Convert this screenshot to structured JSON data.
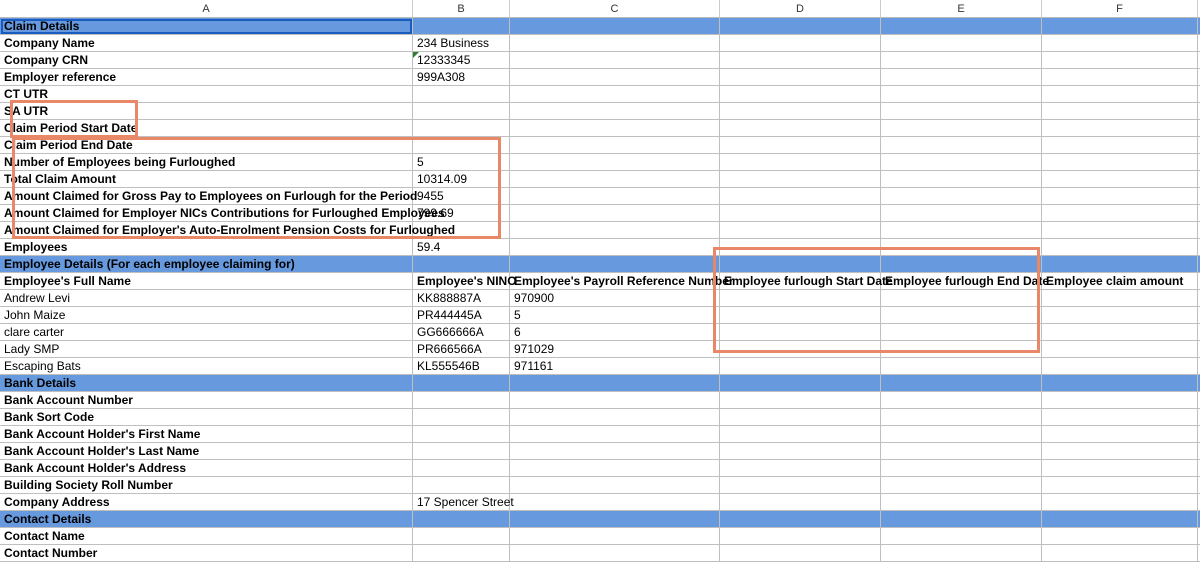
{
  "columns": [
    "A",
    "B",
    "C",
    "D",
    "E",
    "F"
  ],
  "sections": {
    "claim_details_header": "Claim Details",
    "employee_details_header": "Employee Details (For each employee claiming for)",
    "bank_details_header": "Bank Details",
    "contact_details_header": "Contact Details"
  },
  "claim_details": {
    "company_name": {
      "label": "Company Name",
      "value": "234 Business"
    },
    "company_crn": {
      "label": "Company CRN",
      "value": "12333345"
    },
    "employer_reference": {
      "label": "Employer reference",
      "value": "999A308"
    },
    "ct_utr": {
      "label": "CT UTR",
      "value": ""
    },
    "sa_utr": {
      "label": "SA UTR",
      "value": ""
    },
    "claim_period_start": {
      "label": "Claim Period Start Date",
      "value": ""
    },
    "claim_period_end": {
      "label": "Claim Period End Date",
      "value": ""
    },
    "num_employees": {
      "label": "Number of Employees being Furloughed",
      "value": "5"
    },
    "total_claim": {
      "label": "Total Claim Amount",
      "value": "10314.09"
    },
    "gross_pay": {
      "label": "Amount Claimed for Gross Pay to Employees on Furlough for the Period",
      "value": "9455"
    },
    "nics": {
      "label": "Amount Claimed for Employer NICs Contributions for Furloughed Employees",
      "value": "799.69"
    },
    "pension1": {
      "label": "Amount Claimed for Employer's Auto-Enrolment Pension Costs for Furloughed",
      "value": ""
    },
    "pension2": {
      "label": "Employees",
      "value": "59.4"
    }
  },
  "employee_columns": {
    "name": "Employee's Full Name",
    "nino": "Employee's NINO",
    "payroll": "Employee's Payroll Reference Number",
    "start": "Employee furlough Start Date",
    "end": "Employee furlough End Date",
    "amount": "Employee claim amount"
  },
  "employees": [
    {
      "name": "Andrew Levi",
      "nino": "KK888887A",
      "payroll": "970900",
      "start": "",
      "end": "",
      "amount": ""
    },
    {
      "name": "John Maize",
      "nino": "PR444445A",
      "payroll": "5",
      "start": "",
      "end": "",
      "amount": ""
    },
    {
      "name": "clare carter",
      "nino": "GG666666A",
      "payroll": "6",
      "start": "",
      "end": "",
      "amount": ""
    },
    {
      "name": "Lady SMP",
      "nino": "PR666566A",
      "payroll": "971029",
      "start": "",
      "end": "",
      "amount": ""
    },
    {
      "name": "Escaping Bats",
      "nino": "KL555546B",
      "payroll": "971161",
      "start": "",
      "end": "",
      "amount": ""
    }
  ],
  "bank_details": {
    "account_number": {
      "label": "Bank Account Number",
      "value": ""
    },
    "sort_code": {
      "label": "Bank Sort Code",
      "value": ""
    },
    "holder_first": {
      "label": "Bank Account Holder's First Name",
      "value": ""
    },
    "holder_last": {
      "label": "Bank Account Holder's Last Name",
      "value": ""
    },
    "holder_address": {
      "label": "Bank Account Holder's Address",
      "value": ""
    },
    "bsrn": {
      "label": "Building Society Roll Number",
      "value": ""
    },
    "company_address": {
      "label": "Company Address",
      "value": "17 Spencer Street"
    }
  },
  "contact_details": {
    "name": {
      "label": "Contact Name",
      "value": ""
    },
    "number": {
      "label": "Contact Number",
      "value": ""
    }
  }
}
